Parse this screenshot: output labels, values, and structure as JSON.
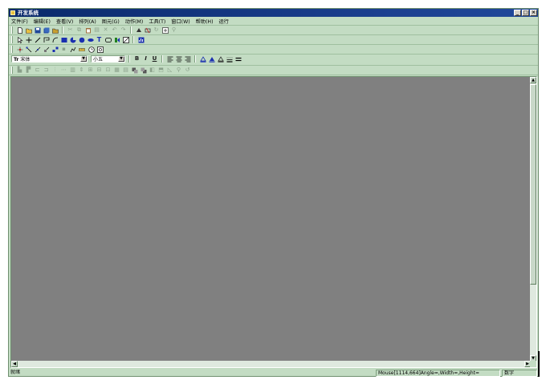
{
  "window": {
    "title": "开发系统",
    "min_label": "_",
    "max_label": "□",
    "close_label": "×"
  },
  "menu": [
    "文件(F)",
    "编辑(E)",
    "查看(V)",
    "排列(A)",
    "图元(G)",
    "动作(M)",
    "工具(T)",
    "窗口(W)",
    "帮助(H)",
    "运行"
  ],
  "toolbar_row1": [
    "new-icon",
    "open-icon",
    "save-icon",
    "save-all-icon",
    "folder-icon",
    "cut-icon",
    "copy-icon",
    "paste-icon",
    "format-painter-icon",
    "delete-icon",
    "undo-icon",
    "redo-icon",
    "group-icon",
    "ungroup-icon",
    "rotate-icon",
    "fit-icon",
    "run-icon"
  ],
  "toolbar_row2": [
    "pointer-icon",
    "cross-icon",
    "line-icon",
    "polyline-icon",
    "arc-icon",
    "rectangle-icon",
    "pie-icon",
    "circle-icon",
    "ellipse-icon",
    "text-icon",
    "rounded-rect-icon",
    "bitmap-icon",
    "frame-icon",
    "chart-icon"
  ],
  "toolbar_row3": [
    "snap-icon",
    "align-line-icon",
    "connector-icon",
    "scale-icon",
    "resize-icon",
    "lock-icon",
    "stretch-icon",
    "ruler-icon",
    "clock-icon",
    "properties-icon"
  ],
  "format_bar": {
    "font_prefix": "Tr",
    "font_name": "宋体",
    "font_size": "小五",
    "bold": "B",
    "italic": "I",
    "underline": "U"
  },
  "status": {
    "ready": "就绪",
    "coords": "Mouse[1114,664]Angle=,Width=,Height=",
    "mode": "数字"
  },
  "colors": {
    "chrome": "#c3dcc3",
    "titlebar": "#0a2a6b",
    "canvas": "#808080"
  }
}
